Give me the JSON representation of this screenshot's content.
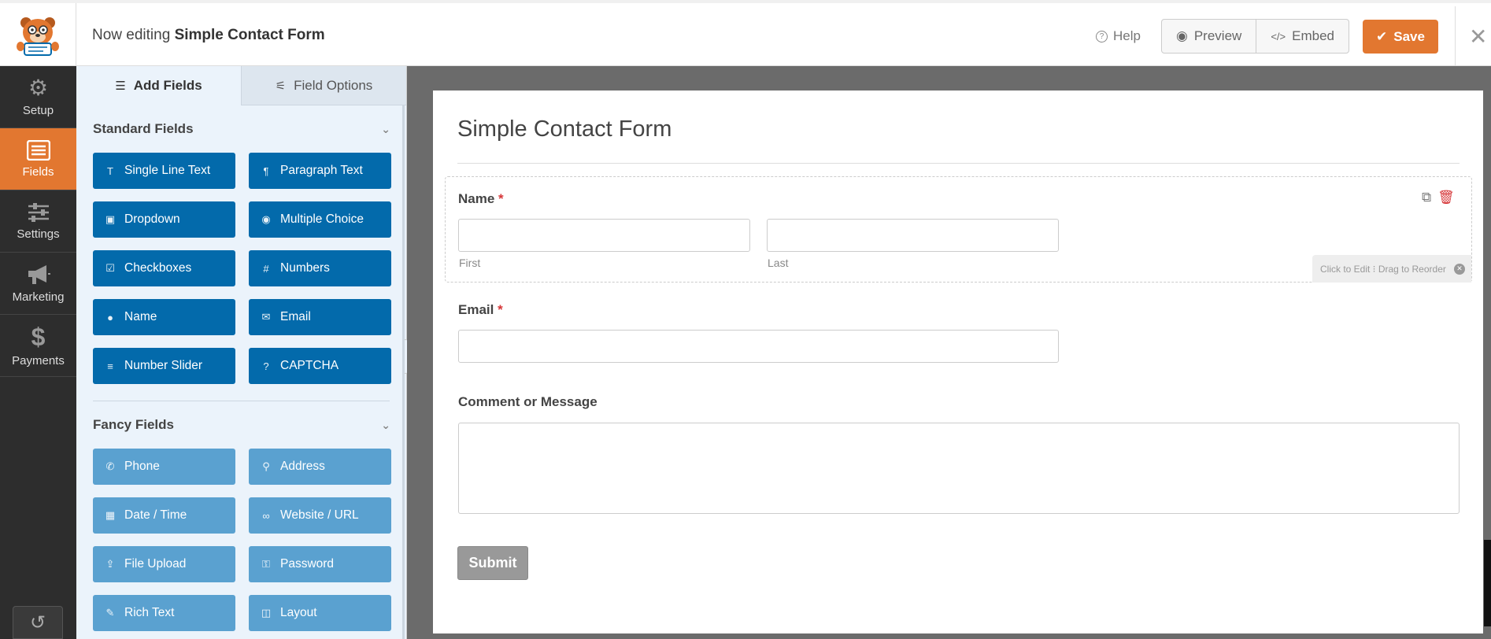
{
  "header": {
    "editing_prefix": "Now editing",
    "form_name": "Simple Contact Form",
    "help_label": "Help",
    "preview_label": "Preview",
    "embed_label": "Embed",
    "save_label": "Save"
  },
  "leftnav": {
    "items": [
      {
        "label": "Setup",
        "icon": "gear-icon"
      },
      {
        "label": "Fields",
        "icon": "list-icon",
        "active": true
      },
      {
        "label": "Settings",
        "icon": "sliders-icon"
      },
      {
        "label": "Marketing",
        "icon": "megaphone-icon"
      },
      {
        "label": "Payments",
        "icon": "dollar-icon"
      }
    ]
  },
  "panel": {
    "tabs": [
      {
        "label": "Add Fields",
        "icon": "list-icon",
        "active": true
      },
      {
        "label": "Field Options",
        "icon": "sliders-icon"
      }
    ],
    "standard": {
      "title": "Standard Fields",
      "fields": [
        {
          "label": "Single Line Text",
          "icon": "text-icon"
        },
        {
          "label": "Paragraph Text",
          "icon": "paragraph-icon"
        },
        {
          "label": "Dropdown",
          "icon": "dropdown-icon"
        },
        {
          "label": "Multiple Choice",
          "icon": "radio-icon"
        },
        {
          "label": "Checkboxes",
          "icon": "checkbox-icon"
        },
        {
          "label": "Numbers",
          "icon": "hash-icon"
        },
        {
          "label": "Name",
          "icon": "user-icon"
        },
        {
          "label": "Email",
          "icon": "envelope-icon"
        },
        {
          "label": "Number Slider",
          "icon": "slider-icon"
        },
        {
          "label": "CAPTCHA",
          "icon": "question-icon"
        }
      ]
    },
    "fancy": {
      "title": "Fancy Fields",
      "fields": [
        {
          "label": "Phone",
          "icon": "phone-icon"
        },
        {
          "label": "Address",
          "icon": "map-pin-icon"
        },
        {
          "label": "Date / Time",
          "icon": "calendar-icon"
        },
        {
          "label": "Website / URL",
          "icon": "link-icon"
        },
        {
          "label": "File Upload",
          "icon": "upload-icon"
        },
        {
          "label": "Password",
          "icon": "lock-icon"
        },
        {
          "label": "Rich Text",
          "icon": "edit-icon"
        },
        {
          "label": "Layout",
          "icon": "columns-icon"
        }
      ]
    }
  },
  "form": {
    "title": "Simple Contact Form",
    "name_label": "Name",
    "name_first": "First",
    "name_last": "Last",
    "email_label": "Email",
    "comment_label": "Comment or Message",
    "required_mark": "*",
    "hint": "Click to Edit  ⁝ Drag to Reorder",
    "submit_label": "Submit"
  },
  "colors": {
    "accent": "#e27730",
    "field_button": "#036aab",
    "fancy_button": "#5aa1d0",
    "nav_bg": "#2d2d2d"
  }
}
